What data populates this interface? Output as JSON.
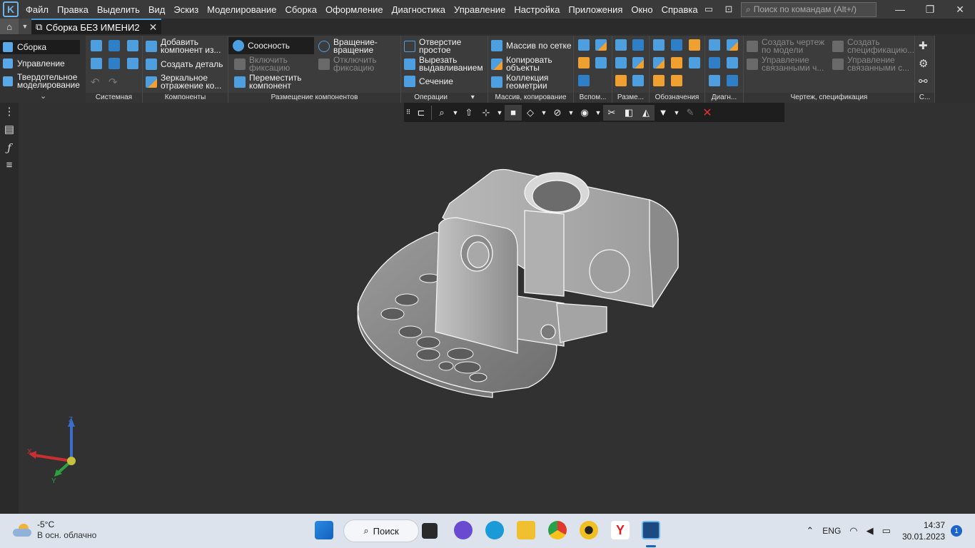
{
  "app": {
    "menu": [
      "Файл",
      "Правка",
      "Выделить",
      "Вид",
      "Эскиз",
      "Моделирование",
      "Сборка",
      "Оформление",
      "Диагностика",
      "Управление",
      "Настройка",
      "Приложения",
      "Окно",
      "Справка"
    ],
    "command_search_placeholder": "Поиск по командам (Alt+/)",
    "document_tab": "Сборка БЕЗ ИМЕНИ2"
  },
  "ribbon": {
    "left_panel": {
      "items": [
        "Сборка",
        "Управление",
        "Твердотельное моделирование"
      ],
      "collapse": "⌄"
    },
    "groups": {
      "system": {
        "label": "Системная"
      },
      "components": {
        "label": "Компоненты",
        "add_component": "Добавить компонент из...",
        "create_part": "Создать деталь",
        "mirror": "Зеркальное отражение ко..."
      },
      "placement": {
        "label": "Размещение компонентов",
        "coaxial": "Соосность",
        "rotate": "Вращение-вращение",
        "enable_fix": "Включить фиксацию",
        "disable_fix": "Отключить фиксацию",
        "move": "Переместить компонент"
      },
      "operations": {
        "label": "Операции",
        "hole": "Отверстие простое",
        "cut_extrude": "Вырезать выдавливанием",
        "section": "Сечение"
      },
      "arrays": {
        "label": "Массив, копирование",
        "grid_array": "Массив по сетке",
        "copy_objects": "Копировать объекты",
        "geometry_collection": "Коллекция геометрии"
      },
      "aux": {
        "label": "Вспом..."
      },
      "dimensions": {
        "label": "Разме..."
      },
      "designations": {
        "label": "Обозначения"
      },
      "diagnostics": {
        "label": "Диагн..."
      },
      "drawing": {
        "label": "Чертеж, спецификация",
        "create_drawing": "Создать чертеж по модели",
        "manage_linked_drawings": "Управление связанными ч...",
        "create_spec": "Создать спецификацию...",
        "manage_linked_specs": "Управление связанными с..."
      },
      "last": {
        "label": "С..."
      }
    }
  },
  "axis": {
    "x": "X",
    "y": "Y",
    "z": "Z"
  },
  "taskbar": {
    "weather_temp": "-5°C",
    "weather_desc": "В осн. облачно",
    "search_label": "Поиск",
    "lang": "ENG",
    "time": "14:37",
    "date": "30.01.2023",
    "notifications": "1"
  },
  "colors": {
    "accent": "#4e9fe0",
    "ribbon_bg": "#3c3c3c",
    "viewport_bg": "#313131"
  }
}
